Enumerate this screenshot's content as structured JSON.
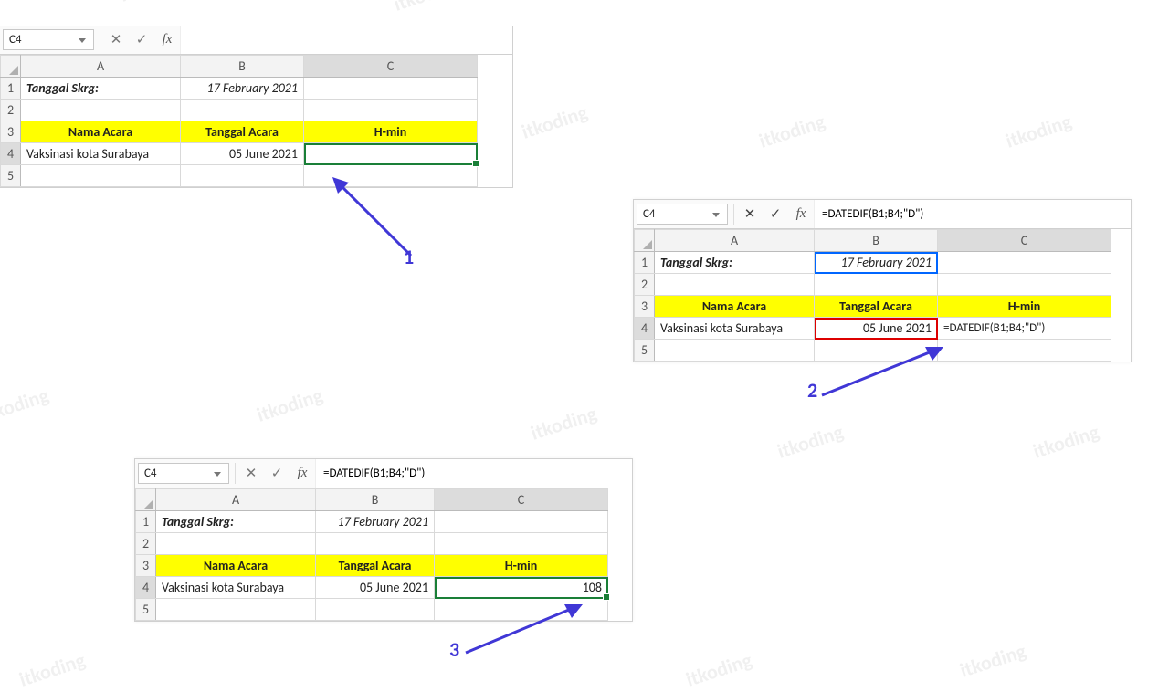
{
  "panel1": {
    "cellref": "C4",
    "formula": "",
    "date_label": "Tanggal Skrg:",
    "today": "17 February 2021",
    "h_nama": "Nama Acara",
    "h_tgl": "Tanggal Acara",
    "h_hmin": "H-min",
    "event": "Vaksinasi kota Surabaya",
    "event_date": "05 June 2021",
    "result": "",
    "colA": "A",
    "colB": "B",
    "colC": "C",
    "r1": "1",
    "r2": "2",
    "r3": "3",
    "r4": "4",
    "r5": "5"
  },
  "panel2": {
    "cellref": "C4",
    "formula": "=DATEDIF(B1;B4;\"D\")",
    "date_label": "Tanggal Skrg:",
    "today": "17 February 2021",
    "h_nama": "Nama Acara",
    "h_tgl": "Tanggal Acara",
    "h_hmin": "H-min",
    "event": "Vaksinasi kota Surabaya",
    "event_date": "05 June 2021",
    "result": "=DATEDIF(B1;B4;\"D\")",
    "colA": "A",
    "colB": "B",
    "colC": "C",
    "r1": "1",
    "r2": "2",
    "r3": "3",
    "r4": "4",
    "r5": "5"
  },
  "panel3": {
    "cellref": "C4",
    "formula": "=DATEDIF(B1;B4;\"D\")",
    "date_label": "Tanggal Skrg:",
    "today": "17 February 2021",
    "h_nama": "Nama Acara",
    "h_tgl": "Tanggal Acara",
    "h_hmin": "H-min",
    "event": "Vaksinasi kota Surabaya",
    "event_date": "05 June 2021",
    "result": "108",
    "colA": "A",
    "colB": "B",
    "colC": "C",
    "r1": "1",
    "r2": "2",
    "r3": "3",
    "r4": "4",
    "r5": "5"
  },
  "anno": {
    "n1": "1",
    "n2": "2",
    "n3": "3"
  },
  "watermark": "itkoding"
}
